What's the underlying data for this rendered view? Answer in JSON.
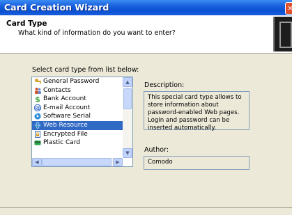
{
  "window": {
    "title": "Card Creation Wizard",
    "close_glyph": "×"
  },
  "header": {
    "title": "Card Type",
    "subtitle": "What kind of information do you want to enter?"
  },
  "list": {
    "label": "Select card type from list below:",
    "selected": "Web Resource",
    "items": [
      {
        "label": "General Password",
        "icon": "key-icon",
        "color": "#d8a22a"
      },
      {
        "label": "Contacts",
        "icon": "people-icon",
        "color": "#d0552a"
      },
      {
        "label": "Bank Account",
        "icon": "dollar-icon",
        "color": "#3aa33a"
      },
      {
        "label": "E-mail Account",
        "icon": "at-icon",
        "color": "#3266c8"
      },
      {
        "label": "Software Serial",
        "icon": "disc-icon",
        "color": "#2f8fd8"
      },
      {
        "label": "Web Resource",
        "icon": "globe-icon",
        "color": "#2a7fd4"
      },
      {
        "label": "Encrypted File",
        "icon": "file-lock-icon",
        "color": "#3a6fb8"
      },
      {
        "label": "Plastic Card",
        "icon": "card-icon",
        "color": "#2ea24a"
      }
    ],
    "scroll_up": "▲",
    "scroll_down": "▼",
    "scroll_left": "◀",
    "scroll_right": "▶"
  },
  "description": {
    "label": "Description:",
    "text": "This special card type allows to store information about password-enabled Web pages. Login and password can be inserted automatically."
  },
  "author": {
    "label": "Author:",
    "value": "Comodo"
  },
  "colors": {
    "title_bar": "#0a4fd0",
    "selection": "#316ac5",
    "dialog_bg": "#ece9d8"
  }
}
